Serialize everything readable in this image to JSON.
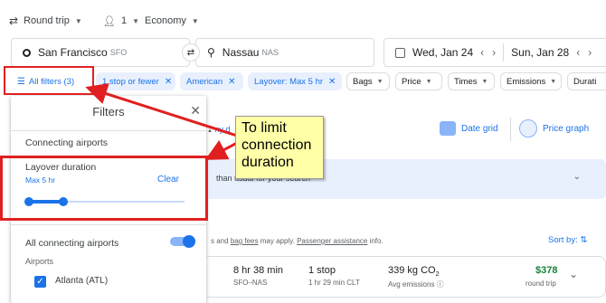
{
  "top": {
    "trip_type": "Round trip",
    "passengers": "1",
    "cabin": "Economy"
  },
  "search": {
    "origin": "San Francisco",
    "origin_code": "SFO",
    "destination": "Nassau",
    "destination_code": "NAS",
    "depart_date": "Wed, Jan 24",
    "return_date": "Sun, Jan 28"
  },
  "chips": {
    "all_filters": "All filters (3)",
    "stops": "1 stop or fewer",
    "airline": "American",
    "layover": "Layover: Max 5 hr",
    "bags": "Bags",
    "price": "Price",
    "times": "Times",
    "emissions": "Emissions",
    "duration": "Durati"
  },
  "panel": {
    "title": "Filters",
    "section_connecting": "Connecting airports",
    "layover_label": "Layover duration",
    "layover_value": "Max 5 hr",
    "clear": "Clear",
    "slider_fraction": 0.22,
    "all_connecting": "All connecting airports",
    "airports_label": "Airports",
    "airport_1": "Atlanta (ATL)"
  },
  "annotation": {
    "line1": "To limit",
    "line2": "connection",
    "line3": "duration"
  },
  "main": {
    "any_dates": "ny d",
    "date_grid": "Date grid",
    "price_graph": "Price graph",
    "banner_text": "than usual for your search",
    "fees_prefix": "s and",
    "bag_fees": "bag fees",
    "fees_mid": "may apply.",
    "passenger_assistance": "Passenger assistance",
    "fees_suffix": "info.",
    "sort_by": "Sort by:",
    "result": {
      "duration": "8 hr 38 min",
      "route": "SFO–NAS",
      "stops": "1 stop",
      "layover": "1 hr 29 min CLT",
      "emissions_value": "339 kg CO",
      "emissions_sub": "2",
      "emissions_label": "Avg emissions",
      "price": "$378",
      "price_label": "round trip"
    }
  },
  "colors": {
    "accent": "#1a73e8",
    "price_green": "#188038",
    "annotation_red": "#e02020",
    "callout_yellow": "#ffffa8"
  }
}
